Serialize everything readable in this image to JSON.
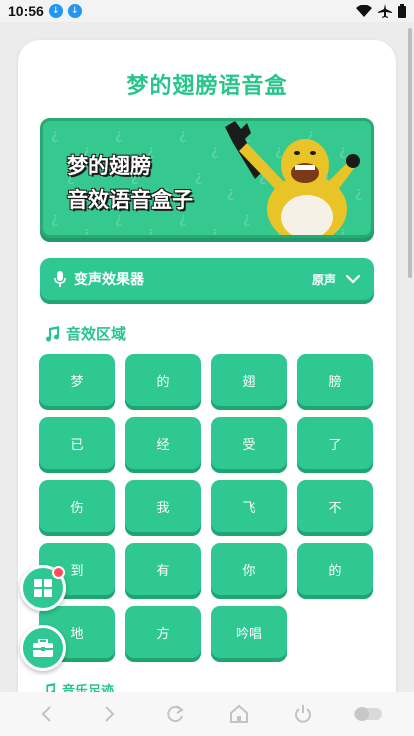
{
  "status_bar": {
    "time": "10:56"
  },
  "app": {
    "title": "梦的翅膀语音盒",
    "banner_line1": "梦的翅膀",
    "banner_line2": "音效语音盒子"
  },
  "voice_changer": {
    "label": "变声效果器",
    "value": "原声"
  },
  "sections": {
    "sound_effects": "音效区域",
    "music": "音乐足迹"
  },
  "sound_buttons": [
    "梦",
    "的",
    "翅",
    "膀",
    "已",
    "经",
    "受",
    "了",
    "伤",
    "我",
    "飞",
    "不",
    "到",
    "有",
    "你",
    "的",
    "地",
    "方",
    "吟唱"
  ],
  "colors": {
    "accent": "#2fc892",
    "title": "#27c48c",
    "badge": "#ff4d5a"
  },
  "icons": {
    "voice": "microphone-icon",
    "section": "music-note-icon",
    "fab1": "grid-icon",
    "fab2": "toolbox-icon",
    "nav": [
      "back-arrow-icon",
      "forward-arrow-icon",
      "reload-icon",
      "home-icon",
      "power-icon",
      "toggle-icon"
    ]
  }
}
